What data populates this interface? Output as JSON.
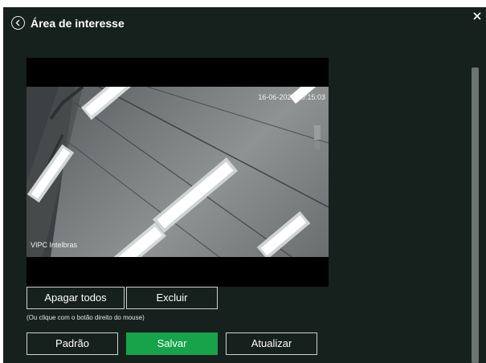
{
  "dialog": {
    "title": "Área de interesse",
    "back_icon": "chevron-left-circle-icon",
    "close_icon": "close-icon"
  },
  "video": {
    "timestamp": "16-06-2024 10:15:03",
    "camera_name": "VIPC Intelbras"
  },
  "actions": {
    "clear_all_label": "Apagar todos",
    "delete_label": "Excluir",
    "hint": "(Ou clique com o botão direito do mouse)"
  },
  "footer": {
    "default_label": "Padrão",
    "save_label": "Salvar",
    "refresh_label": "Atualizar"
  },
  "colors": {
    "background": "#16201c",
    "primary": "#16a34a",
    "text": "#ffffff"
  }
}
